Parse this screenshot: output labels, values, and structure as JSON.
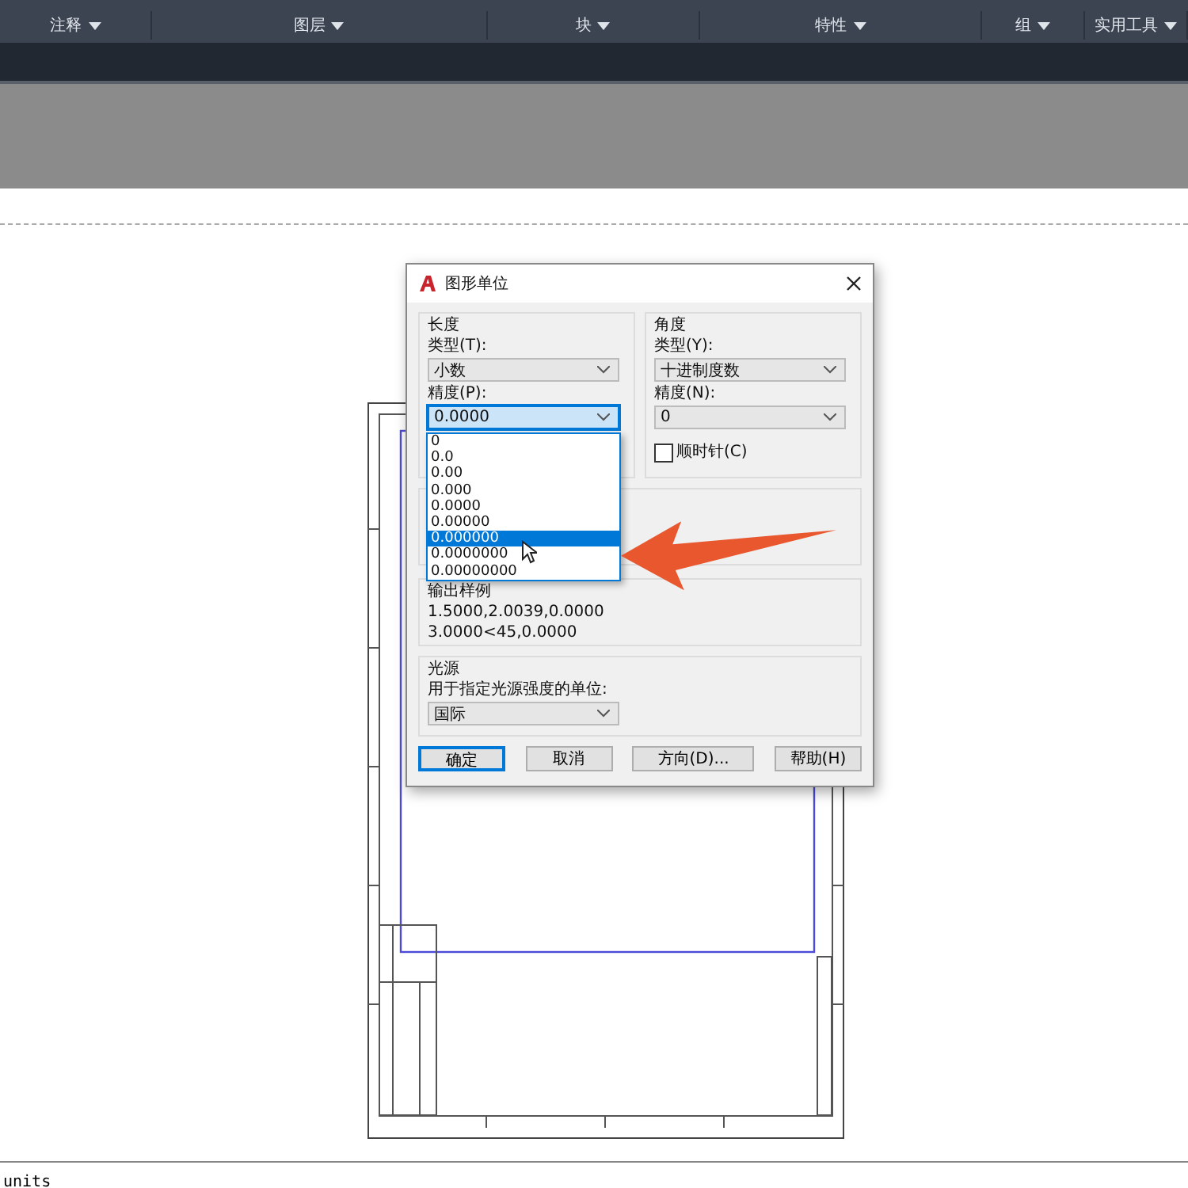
{
  "ribbon": {
    "panels": [
      {
        "label": "注释"
      },
      {
        "label": "图层"
      },
      {
        "label": "块"
      },
      {
        "label": "特性"
      },
      {
        "label": "组"
      },
      {
        "label": "实用工具"
      }
    ]
  },
  "dialog": {
    "title": "图形单位",
    "length": {
      "heading": "长度",
      "type_label": "类型(T):",
      "type_value": "小数",
      "precision_label": "精度(P):",
      "precision_value": "0.0000",
      "list_open": true,
      "precision_options": [
        {
          "label": "0",
          "selected": false
        },
        {
          "label": "0.0",
          "selected": false
        },
        {
          "label": "0.00",
          "selected": false
        },
        {
          "label": "0.000",
          "selected": false
        },
        {
          "label": "0.0000",
          "selected": false
        },
        {
          "label": "0.00000",
          "selected": false
        },
        {
          "label": "0.000000",
          "selected": true
        },
        {
          "label": "0.0000000",
          "selected": false
        },
        {
          "label": "0.00000000",
          "selected": false
        }
      ]
    },
    "angle": {
      "heading": "角度",
      "type_label": "类型(Y):",
      "type_value": "十进制度数",
      "precision_label": "精度(N):",
      "precision_value": "0",
      "clockwise": {
        "label": "顺时针(C)",
        "checked": false
      }
    },
    "output_sample": {
      "heading": "输出样例",
      "lines": [
        "1.5000,2.0039,0.0000",
        "3.0000<45,0.0000"
      ]
    },
    "light_source": {
      "heading": "光源",
      "label": "用于指定光源强度的单位:",
      "value": "国际"
    },
    "buttons": [
      {
        "label": "确定",
        "default": true
      },
      {
        "label": "取消",
        "default": false
      },
      {
        "label": "方向(D)...",
        "default": false
      },
      {
        "label": "帮助(H)",
        "default": false
      }
    ]
  },
  "status_bar": {
    "command": "units"
  }
}
